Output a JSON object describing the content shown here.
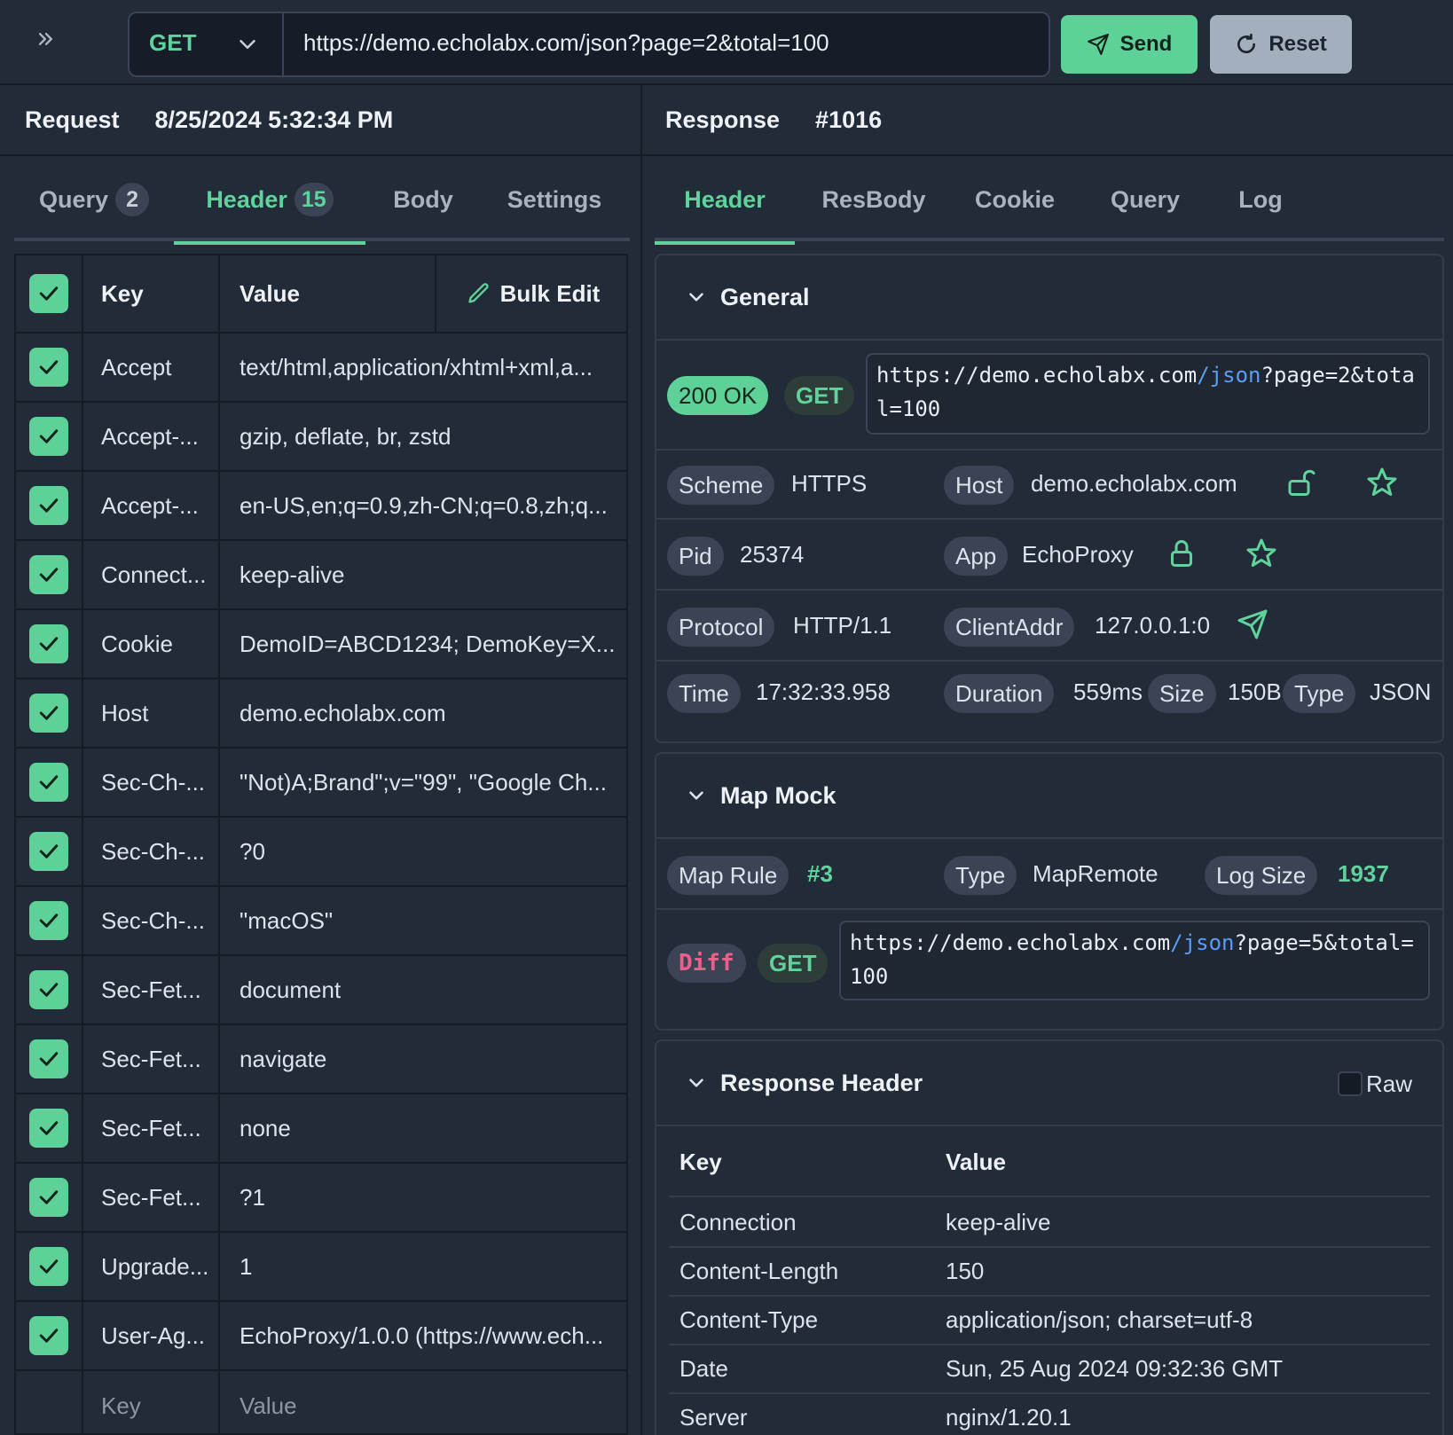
{
  "toolbar": {
    "method": "GET",
    "url": "https://demo.echolabx.com/json?page=2&total=100",
    "send_label": "Send",
    "reset_label": "Reset",
    "expand_icon": "double-chevron-right-icon"
  },
  "request": {
    "title": "Request",
    "timestamp": "8/25/2024 5:32:34 PM",
    "tabs": [
      {
        "label": "Query",
        "badge": "2"
      },
      {
        "label": "Header",
        "badge": "15"
      },
      {
        "label": "Body",
        "badge": ""
      },
      {
        "label": "Settings",
        "badge": ""
      }
    ],
    "active_tab": "Header",
    "table": {
      "col_key": "Key",
      "col_value": "Value",
      "bulk_edit": "Bulk Edit",
      "rows": [
        {
          "key": "Accept",
          "value": "text/html,application/xhtml+xml,a..."
        },
        {
          "key": "Accept-...",
          "value": "gzip, deflate, br, zstd"
        },
        {
          "key": "Accept-...",
          "value": "en-US,en;q=0.9,zh-CN;q=0.8,zh;q..."
        },
        {
          "key": "Connect...",
          "value": "keep-alive"
        },
        {
          "key": "Cookie",
          "value": "DemoID=ABCD1234; DemoKey=X..."
        },
        {
          "key": "Host",
          "value": "demo.echolabx.com"
        },
        {
          "key": "Sec-Ch-...",
          "value": "\"Not)A;Brand\";v=\"99\", \"Google Ch..."
        },
        {
          "key": "Sec-Ch-...",
          "value": "?0"
        },
        {
          "key": "Sec-Ch-...",
          "value": "\"macOS\""
        },
        {
          "key": "Sec-Fet...",
          "value": "document"
        },
        {
          "key": "Sec-Fet...",
          "value": "navigate"
        },
        {
          "key": "Sec-Fet...",
          "value": "none"
        },
        {
          "key": "Sec-Fet...",
          "value": "?1"
        },
        {
          "key": "Upgrade...",
          "value": "1"
        },
        {
          "key": "User-Ag...",
          "value": "EchoProxy/1.0.0 (https://www.ech..."
        }
      ],
      "new_key_placeholder": "Key",
      "new_value_placeholder": "Value"
    }
  },
  "response": {
    "title": "Response",
    "id": "#1016",
    "tabs": [
      "Header",
      "ResBody",
      "Cookie",
      "Query",
      "Log"
    ],
    "active_tab": "Header",
    "general": {
      "title": "General",
      "status": "200 OK",
      "method": "GET",
      "url_host": "https://demo.echolabx.com",
      "url_path": "/json",
      "url_query": "?page=2&total=100",
      "scheme_label": "Scheme",
      "scheme": "HTTPS",
      "host_label": "Host",
      "host": "demo.echolabx.com",
      "pid_label": "Pid",
      "pid": "25374",
      "app_label": "App",
      "app": "EchoProxy",
      "protocol_label": "Protocol",
      "protocol": "HTTP/1.1",
      "client_label": "ClientAddr",
      "client": "127.0.0.1:0",
      "time_label": "Time",
      "time": "17:32:33.958",
      "duration_label": "Duration",
      "duration": "559ms",
      "size_label": "Size",
      "size": "150B",
      "type_label": "Type",
      "type": "JSON"
    },
    "map_mock": {
      "title": "Map Mock",
      "rule_label": "Map Rule",
      "rule": "#3",
      "type_label": "Type",
      "type": "MapRemote",
      "log_size_label": "Log Size",
      "log_size": "1937",
      "diff_label": "Diff",
      "method": "GET",
      "url_host": "https://demo.echolabx.com",
      "url_path": "/json",
      "url_query": "?page=5&total=100"
    },
    "response_header": {
      "title": "Response Header",
      "raw_label": "Raw",
      "col_key": "Key",
      "col_value": "Value",
      "rows": [
        {
          "key": "Connection",
          "value": "keep-alive"
        },
        {
          "key": "Content-Length",
          "value": "150"
        },
        {
          "key": "Content-Type",
          "value": "application/json; charset=utf-8"
        },
        {
          "key": "Date",
          "value": "Sun, 25 Aug 2024 09:32:36 GMT"
        },
        {
          "key": "Server",
          "value": "nginx/1.20.1"
        }
      ]
    }
  },
  "colors": {
    "accent": "#5ed199",
    "background": "#222b38",
    "link_blue": "#5b9cf5",
    "diff_pink": "#ec5f8c",
    "reset_gray": "#a4afbe"
  }
}
